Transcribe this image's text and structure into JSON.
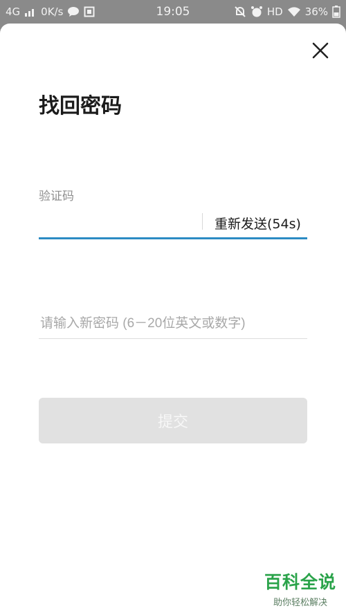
{
  "status_bar": {
    "network": "4G",
    "speed": "0K/s",
    "time": "19:05",
    "hd": "HD",
    "battery": "36%"
  },
  "dialog": {
    "title": "找回密码",
    "code_label": "验证码",
    "code_value": "",
    "resend_label": "重新发送(54s)",
    "password_placeholder": "请输入新密码 (6－20位英文或数字)",
    "submit_label": "提交"
  },
  "watermark": {
    "title": "百科全说",
    "subtitle": "助你轻松解决"
  },
  "colors": {
    "accent": "#2b8bc3",
    "button_disabled": "#e1e1e1",
    "watermark": "#2aa34a"
  }
}
